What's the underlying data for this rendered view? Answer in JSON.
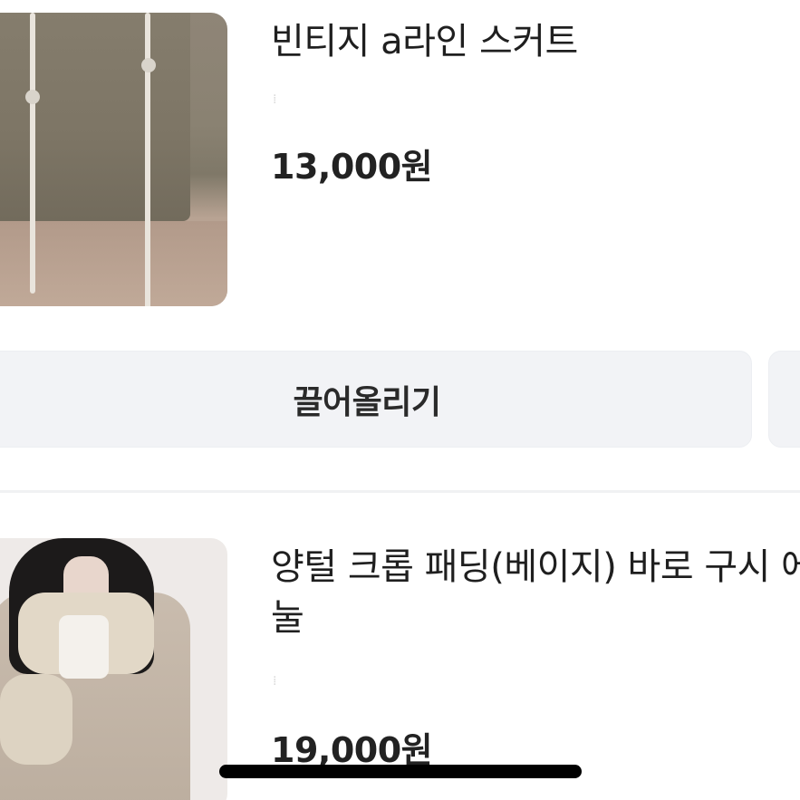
{
  "listings": [
    {
      "title": "빈티지 a라인 스커트",
      "price": "13,000원"
    },
    {
      "title": "양털 크롭 패딩(베이지) 바로 구시 에눌",
      "price": "19,000원"
    }
  ],
  "actions": {
    "bump_label": "끌어올리기"
  }
}
